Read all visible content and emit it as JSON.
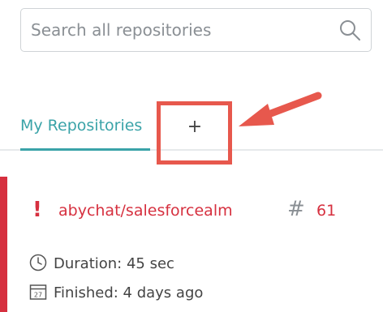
{
  "search": {
    "placeholder": "Search all repositories",
    "value": ""
  },
  "tabs": [
    {
      "label": "My Repositories",
      "active": true
    },
    {
      "label": "+",
      "active": false
    }
  ],
  "repository": {
    "status": "failed",
    "alert_symbol": "!",
    "name": "abychat/salesforcealm",
    "hash_symbol": "#",
    "build_number": "61",
    "duration": "Duration: 45 sec",
    "finished": "Finished: 4 days ago",
    "calendar_day": "27"
  },
  "colors": {
    "accent": "#3aa3a8",
    "error": "#d6303f",
    "annotation": "#e7584d"
  },
  "icons": {
    "search": "search-icon",
    "alert": "exclamation-icon",
    "hash": "hash-icon",
    "duration": "clock-icon",
    "finished": "calendar-icon"
  }
}
